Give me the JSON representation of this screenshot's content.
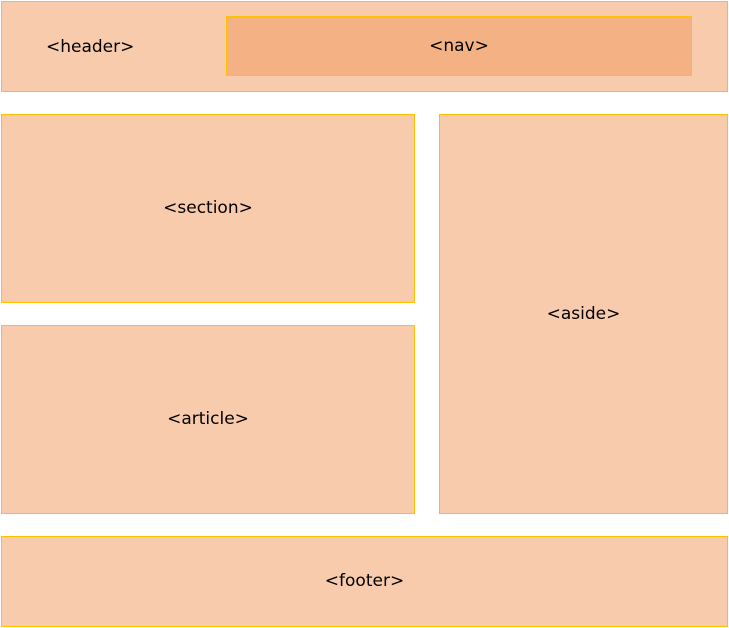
{
  "colors": {
    "block_fill": "#f8cbad",
    "nav_fill": "#f4b183",
    "border": "#ffc000",
    "text": "#000000"
  },
  "blocks": {
    "header": "<header>",
    "nav": "<nav>",
    "section": "<section>",
    "article": "<article>",
    "aside": "<aside>",
    "footer": "<footer>"
  }
}
